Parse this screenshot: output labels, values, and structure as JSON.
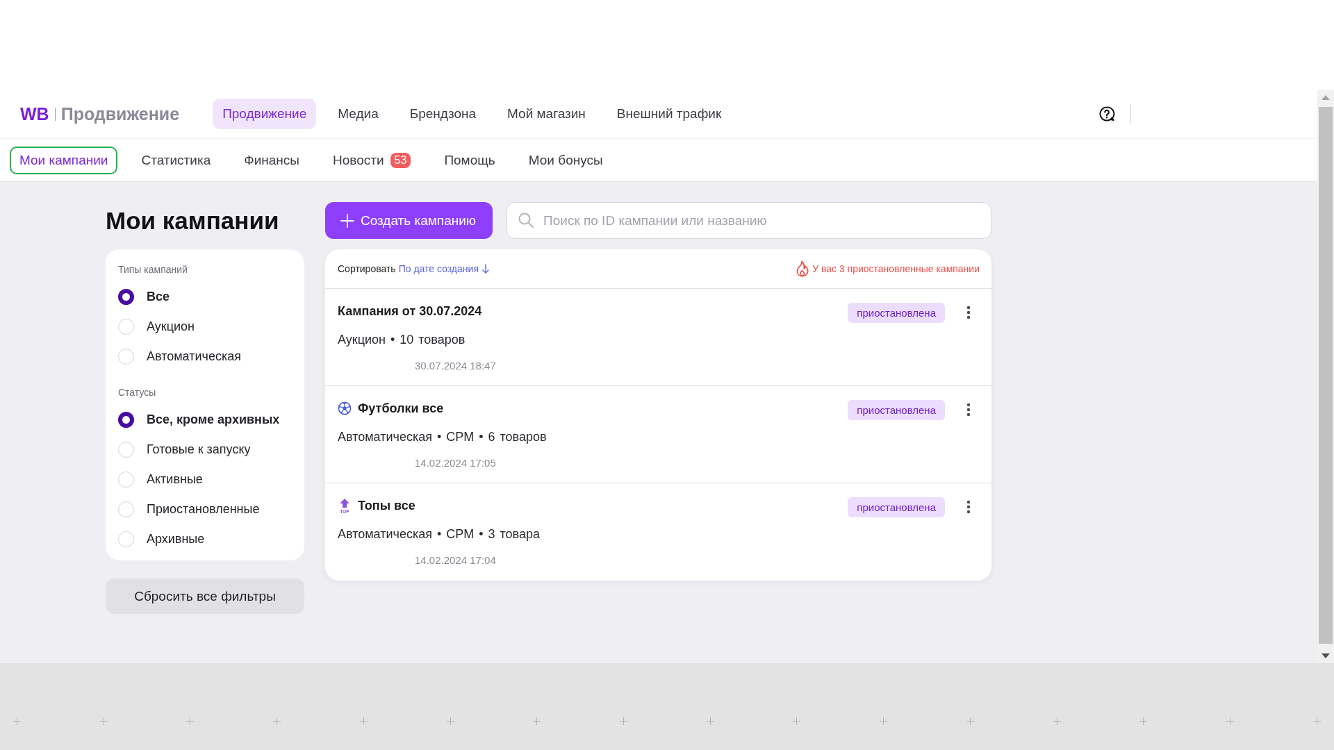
{
  "top_nav": {
    "logo": {
      "brand": "WB",
      "product": "Продвижение"
    },
    "items": [
      {
        "label": "Продвижение",
        "selected": true
      },
      {
        "label": "Медиа",
        "selected": false
      },
      {
        "label": "Брендзона",
        "selected": false
      },
      {
        "label": "Мой магазин",
        "selected": false
      },
      {
        "label": "Внешний трафик",
        "selected": false
      }
    ]
  },
  "sub_nav": {
    "items": [
      {
        "label": "Мои кампании",
        "selected": true
      },
      {
        "label": "Статистика",
        "selected": false
      },
      {
        "label": "Финансы",
        "selected": false
      },
      {
        "label": "Новости",
        "selected": false,
        "badge": "53"
      },
      {
        "label": "Помощь",
        "selected": false
      },
      {
        "label": "Мои бонусы",
        "selected": false
      }
    ]
  },
  "page_title": "Мои кампании",
  "toolbar": {
    "create_button": "Создать кампанию",
    "search": {
      "placeholder": "Поиск по ID кампании или названию"
    }
  },
  "filters": {
    "groups": [
      {
        "title": "Типы кампаний",
        "options": [
          {
            "label": "Все",
            "selected": true
          },
          {
            "label": "Аукцион",
            "selected": false
          },
          {
            "label": "Автоматическая",
            "selected": false
          }
        ]
      },
      {
        "title": "Статусы",
        "options": [
          {
            "label": "Все, кроме архивных",
            "selected": true
          },
          {
            "label": "Готовые к запуску",
            "selected": false
          },
          {
            "label": "Активные",
            "selected": false
          },
          {
            "label": "Приостановленные",
            "selected": false
          },
          {
            "label": "Архивные",
            "selected": false
          }
        ]
      }
    ],
    "reset_button": "Сбросить все фильтры"
  },
  "campaign_list": {
    "sort": {
      "label": "Сортировать",
      "value": "По дате создания"
    },
    "alert": "У вас 3 приостановленные кампании",
    "items": [
      {
        "title": "Кампания от 30.07.2024",
        "meta": "Аукцион • 10 товаров",
        "date": "30.07.2024 18:47",
        "status": "приостановлена"
      },
      {
        "title": "Футболки все",
        "icon": {
          "kind": "ball"
        },
        "meta": "Автоматическая • CPM • 6 товаров",
        "date": "14.02.2024 17:05",
        "status": "приостановлена"
      },
      {
        "title": "Топы все",
        "icon": {
          "kind": "top",
          "text": "TOP"
        },
        "meta": "Автоматическая • CPM • 3 товара",
        "date": "14.02.2024 17:04",
        "status": "приостановлена"
      }
    ]
  }
}
